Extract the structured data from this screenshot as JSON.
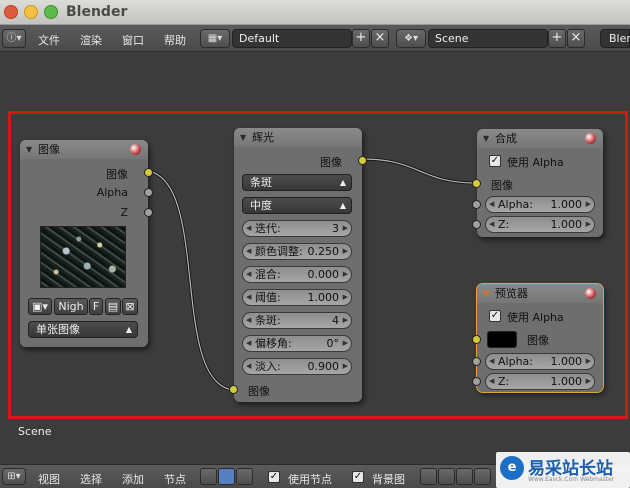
{
  "window": {
    "title": "Blender"
  },
  "topbar": {
    "menus": [
      "文件",
      "渲染",
      "窗口",
      "帮助"
    ],
    "layout_value": "Default",
    "scene_value": "Scene",
    "engine_value": "Blen"
  },
  "nodes": {
    "image": {
      "title": "图像",
      "outputs": [
        "图像",
        "Alpha",
        "Z"
      ],
      "file_name": "Nigh",
      "file_flag": "F",
      "source_value": "单张图像"
    },
    "glare": {
      "title": "辉光",
      "output_label": "图像",
      "type_value": "条斑",
      "quality_value": "中度",
      "fields": [
        {
          "label": "迭代:",
          "value": "3"
        },
        {
          "label": "颜色调整:",
          "value": "0.250"
        },
        {
          "label": "混合:",
          "value": "0.000"
        },
        {
          "label": "阈值:",
          "value": "1.000"
        },
        {
          "label": "条斑:",
          "value": "4"
        },
        {
          "label": "偏移角:",
          "value": "0°"
        },
        {
          "label": "淡入:",
          "value": "0.900"
        }
      ],
      "input_label": "图像"
    },
    "composite": {
      "title": "合成",
      "use_alpha_label": "使用 Alpha",
      "image_label": "图像",
      "alpha_label": "Alpha:",
      "alpha_value": "1.000",
      "z_label": "Z:",
      "z_value": "1.000"
    },
    "viewer": {
      "title": "预览器",
      "use_alpha_label": "使用 Alpha",
      "image_label": "图像",
      "alpha_label": "Alpha:",
      "alpha_value": "1.000",
      "z_label": "Z:",
      "z_value": "1.000"
    }
  },
  "scene_label": "Scene",
  "bottombar": {
    "menus": [
      "视图",
      "选择",
      "添加",
      "节点"
    ],
    "use_nodes_label": "使用节点",
    "backdrop_label": "背景图"
  },
  "watermark": {
    "logo": "e",
    "title": "易采站长站",
    "subtitle": "Www.Easck.Com Webmaster"
  }
}
